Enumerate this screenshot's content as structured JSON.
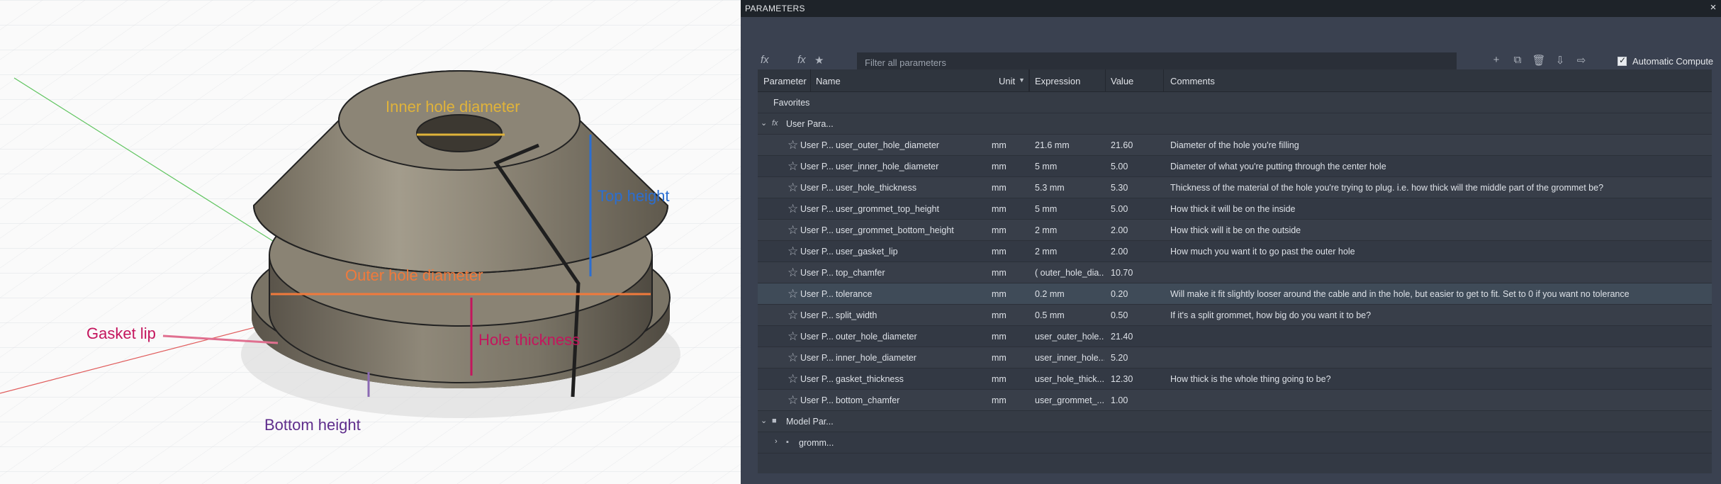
{
  "viewport": {
    "annotations": {
      "inner_hole_diameter": "Inner hole diameter",
      "top_height": "Top height",
      "outer_hole_diameter": "Outer hole diameter",
      "gasket_lip": "Gasket lip",
      "hole_thickness": "Hole thickness",
      "bottom_height": "Bottom height"
    }
  },
  "panel": {
    "title": "PARAMETERS",
    "close": "×",
    "toolbar": {
      "fx": "fx",
      "fx_sub": "fx",
      "fav_star": "★",
      "search_placeholder": "Filter all parameters",
      "auto_compute_label": "Automatic Compute",
      "auto_compute_checked": true
    },
    "columns": [
      "Parameter",
      "Name",
      "Unit",
      "Expression",
      "Value",
      "Comments"
    ],
    "groups": {
      "favorites": "Favorites",
      "user_params": "User Para...",
      "model_params": "Model Par...",
      "model_child": "gromm..."
    },
    "rows": [
      {
        "param": "User P...",
        "name": "user_outer_hole_diameter",
        "unit": "mm",
        "expr": "21.6 mm",
        "value": "21.60",
        "comment": "Diameter of the hole you're filling"
      },
      {
        "param": "User P...",
        "name": "user_inner_hole_diameter",
        "unit": "mm",
        "expr": "5 mm",
        "value": "5.00",
        "comment": "Diameter of what you're putting through the center hole"
      },
      {
        "param": "User P...",
        "name": "user_hole_thickness",
        "unit": "mm",
        "expr": "5.3 mm",
        "value": "5.30",
        "comment": "Thickness of the material of the hole you're trying to plug.  i.e. how thick will the middle part of the grommet be?"
      },
      {
        "param": "User P...",
        "name": "user_grommet_top_height",
        "unit": "mm",
        "expr": "5 mm",
        "value": "5.00",
        "comment": "How thick it will be on the inside"
      },
      {
        "param": "User P...",
        "name": "user_grommet_bottom_height",
        "unit": "mm",
        "expr": "2 mm",
        "value": "2.00",
        "comment": "How thick will it be on the outside"
      },
      {
        "param": "User P...",
        "name": "user_gasket_lip",
        "unit": "mm",
        "expr": "2 mm",
        "value": "2.00",
        "comment": "How much you want it to go past the outer hole"
      },
      {
        "param": "User P...",
        "name": "top_chamfer",
        "unit": "mm",
        "expr": "( outer_hole_dia...",
        "value": "10.70",
        "comment": ""
      },
      {
        "param": "User P...",
        "name": "tolerance",
        "unit": "mm",
        "expr": "0.2 mm",
        "value": "0.20",
        "comment": "Will make it fit slightly looser around the cable and in the hole, but easier to get to fit.  Set to 0 if you want no tolerance"
      },
      {
        "param": "User P...",
        "name": "split_width",
        "unit": "mm",
        "expr": "0.5 mm",
        "value": "0.50",
        "comment": "If it's a split grommet, how big do you want it to be?"
      },
      {
        "param": "User P...",
        "name": "outer_hole_diameter",
        "unit": "mm",
        "expr": "user_outer_hole...",
        "value": "21.40",
        "comment": ""
      },
      {
        "param": "User P...",
        "name": "inner_hole_diameter",
        "unit": "mm",
        "expr": "user_inner_hole...",
        "value": "5.20",
        "comment": ""
      },
      {
        "param": "User P...",
        "name": "gasket_thickness",
        "unit": "mm",
        "expr": "user_hole_thick...",
        "value": "12.30",
        "comment": "How thick is the whole thing going to be?"
      },
      {
        "param": "User P...",
        "name": "bottom_chamfer",
        "unit": "mm",
        "expr": "user_grommet_...",
        "value": "1.00",
        "comment": ""
      }
    ]
  }
}
